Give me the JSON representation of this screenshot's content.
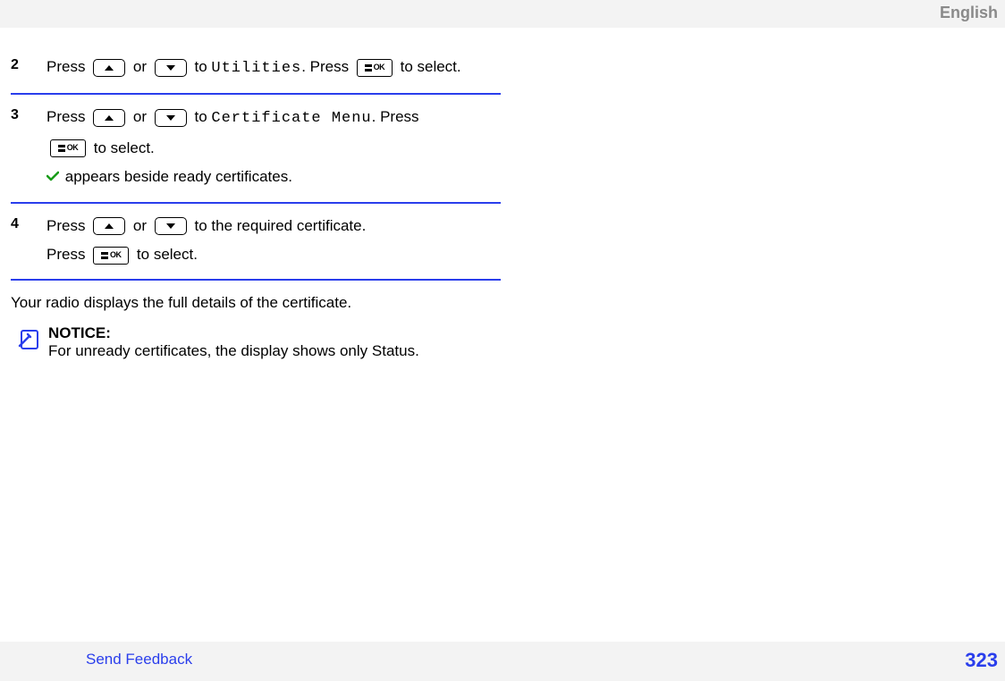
{
  "header": {
    "language": "English"
  },
  "steps": [
    {
      "num": "2",
      "parts": {
        "press1": "Press ",
        "or": " or ",
        "to": " to ",
        "target": "Utilities",
        "after": ". Press ",
        "toselect": " to select."
      }
    },
    {
      "num": "3",
      "parts": {
        "press1": "Press ",
        "or": " or ",
        "to": " to ",
        "target": "Certificate Menu",
        "after": ". Press ",
        "toselect": " to select.",
        "extra": " appears beside ready certificates."
      }
    },
    {
      "num": "4",
      "parts": {
        "press1": "Press ",
        "or": " or ",
        "to": " to the required certificate.",
        "press2": "Press ",
        "toselect": " to select."
      }
    }
  ],
  "after_steps": "Your radio displays the full details of the certificate.",
  "notice": {
    "title": "NOTICE:",
    "body": "For unready certificates, the display shows only Status."
  },
  "footer": {
    "link": "Send Feedback",
    "page": "323"
  },
  "ok_label": "OK"
}
